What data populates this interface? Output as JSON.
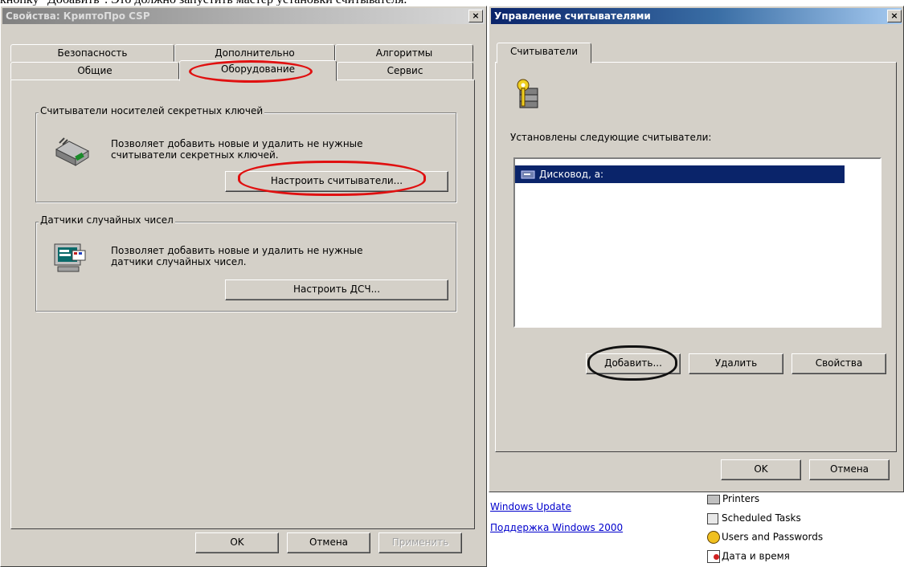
{
  "caption": "кнопку \"Добавить\". Это должно запустить мастер установки считывателя.",
  "left_window": {
    "title": "Свойства: КриптоПро CSP",
    "close_glyph": "×",
    "tabs_back": [
      "Безопасность",
      "Дополнительно",
      "Алгоритмы"
    ],
    "tabs_front": [
      "Общие",
      "Оборудование",
      "Сервис"
    ],
    "active_tab": "Оборудование",
    "readers_group": {
      "label": "Считыватели носителей секретных ключей",
      "description_line1": "Позволяет добавить новые и удалить не нужные",
      "description_line2": "считыватели секретных ключей.",
      "button": "Настроить считыватели..."
    },
    "rng_group": {
      "label": "Датчики случайных чисел",
      "description_line1": "Позволяет добавить новые и удалить не нужные",
      "description_line2": "датчики случайных чисел.",
      "button": "Настроить ДСЧ..."
    },
    "buttons": {
      "ok": "OK",
      "cancel": "Отмена",
      "apply": "Применить"
    }
  },
  "right_window": {
    "title": "Управление считывателями",
    "close_glyph": "×",
    "tab": "Считыватели",
    "installed_label": "Установлены следующие считыватели:",
    "readers": [
      "Дисковод, a:"
    ],
    "buttons": {
      "add": "Добавить...",
      "remove": "Удалить",
      "properties": "Свойства",
      "ok": "OK",
      "cancel": "Отмена"
    }
  },
  "background": {
    "links": [
      "Windows Update",
      "Поддержка Windows 2000"
    ],
    "control_panel_items": [
      "Printers",
      "Scheduled Tasks",
      "Users and Passwords",
      "Дата и время"
    ]
  },
  "colors": {
    "highlight_red": "#e01010",
    "highlight_black": "#111111",
    "selection": "#0a246a",
    "face": "#d4d0c8"
  }
}
